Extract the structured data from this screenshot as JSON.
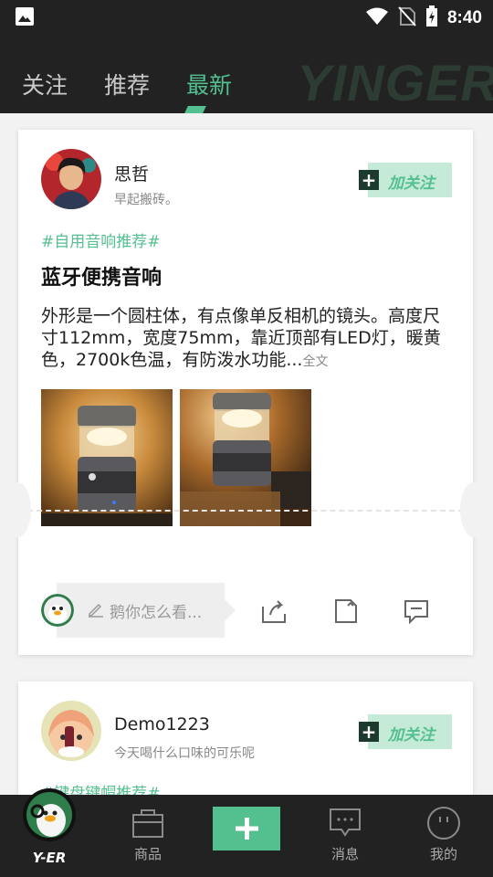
{
  "status_bar": {
    "time": "8:40"
  },
  "top_nav": {
    "tabs": [
      {
        "label": "关注"
      },
      {
        "label": "推荐"
      },
      {
        "label": "最新",
        "active": true
      }
    ],
    "brand_watermark": "YINGER"
  },
  "posts": [
    {
      "author": "思哲",
      "bio": "早起搬砖。",
      "follow_label": "加关注",
      "topic": "#自用音响推荐#",
      "title": "蓝牙便携音响",
      "body": "外形是一个圆柱体，有点像单反相机的镜头。高度尺寸112mm，宽度75mm，靠近顶部有LED灯，暖黄色，2700k色温，有防泼水功能...",
      "more_label": "全文",
      "comment_placeholder": "鹅你怎么看..."
    },
    {
      "author": "Demo1223",
      "bio": "今天喝什么口味的可乐呢",
      "follow_label": "加关注",
      "topic": "#键盘键帽推荐#"
    }
  ],
  "bottom_nav": {
    "logo_text": "Y-ER",
    "items": [
      {
        "label": "商品",
        "icon": "bag-icon"
      },
      {
        "label": "消息",
        "icon": "message-icon"
      },
      {
        "label": "我的",
        "icon": "profile-icon"
      }
    ]
  },
  "colors": {
    "accent": "#54bf8f",
    "dark": "#222222",
    "follow_bg": "#c5ead8"
  }
}
